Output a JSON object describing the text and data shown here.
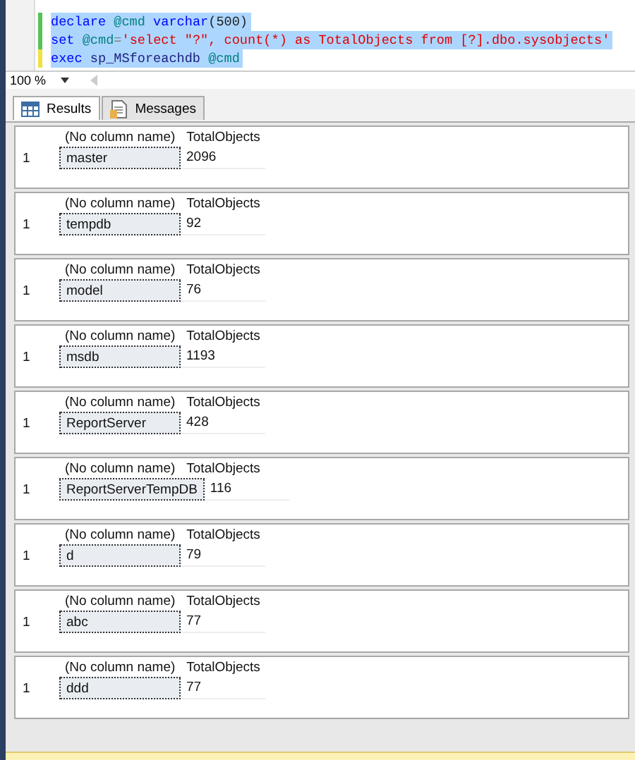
{
  "editor": {
    "lines": [
      {
        "saved": true,
        "tokens": [
          {
            "text": "declare ",
            "kind": "keyword"
          },
          {
            "text": "@cmd ",
            "kind": "variable"
          },
          {
            "text": "varchar",
            "kind": "keyword"
          },
          {
            "text": "(500)",
            "kind": "plain"
          }
        ]
      },
      {
        "saved": true,
        "tokens": [
          {
            "text": "set ",
            "kind": "keyword"
          },
          {
            "text": "@cmd",
            "kind": "variable"
          },
          {
            "text": "=",
            "kind": "operator"
          },
          {
            "text": "'select \"?\", count(*) as TotalObjects from [?].dbo.sysobjects'",
            "kind": "string"
          }
        ]
      },
      {
        "saved": false,
        "tokens": [
          {
            "text": "exec ",
            "kind": "keyword"
          },
          {
            "text": "sp_MSforeachdb ",
            "kind": "plain-blue"
          },
          {
            "text": "@cmd",
            "kind": "variable"
          }
        ]
      }
    ],
    "selected": true
  },
  "zoom": {
    "value": "100 %"
  },
  "tabs": [
    {
      "label": "Results",
      "selected": true
    },
    {
      "label": "Messages",
      "selected": false
    }
  ],
  "grids": [
    {
      "columns": [
        "(No column name)",
        "TotalObjects"
      ],
      "rows": [
        {
          "number": "1",
          "cells": [
            "master",
            "2096"
          ]
        }
      ]
    },
    {
      "columns": [
        "(No column name)",
        "TotalObjects"
      ],
      "rows": [
        {
          "number": "1",
          "cells": [
            "tempdb",
            "92"
          ]
        }
      ]
    },
    {
      "columns": [
        "(No column name)",
        "TotalObjects"
      ],
      "rows": [
        {
          "number": "1",
          "cells": [
            "model",
            "76"
          ]
        }
      ]
    },
    {
      "columns": [
        "(No column name)",
        "TotalObjects"
      ],
      "rows": [
        {
          "number": "1",
          "cells": [
            "msdb",
            "1193"
          ]
        }
      ]
    },
    {
      "columns": [
        "(No column name)",
        "TotalObjects"
      ],
      "rows": [
        {
          "number": "1",
          "cells": [
            "ReportServer",
            "428"
          ]
        }
      ]
    },
    {
      "columns": [
        "(No column name)",
        "TotalObjects"
      ],
      "rows": [
        {
          "number": "1",
          "cells": [
            "ReportServerTempDB",
            "116"
          ]
        }
      ]
    },
    {
      "columns": [
        "(No column name)",
        "TotalObjects"
      ],
      "rows": [
        {
          "number": "1",
          "cells": [
            "d",
            "79"
          ]
        }
      ]
    },
    {
      "columns": [
        "(No column name)",
        "TotalObjects"
      ],
      "rows": [
        {
          "number": "1",
          "cells": [
            "abc",
            "77"
          ]
        }
      ]
    },
    {
      "columns": [
        "(No column name)",
        "TotalObjects"
      ],
      "rows": [
        {
          "number": "1",
          "cells": [
            "ddd",
            "77"
          ]
        }
      ]
    }
  ]
}
